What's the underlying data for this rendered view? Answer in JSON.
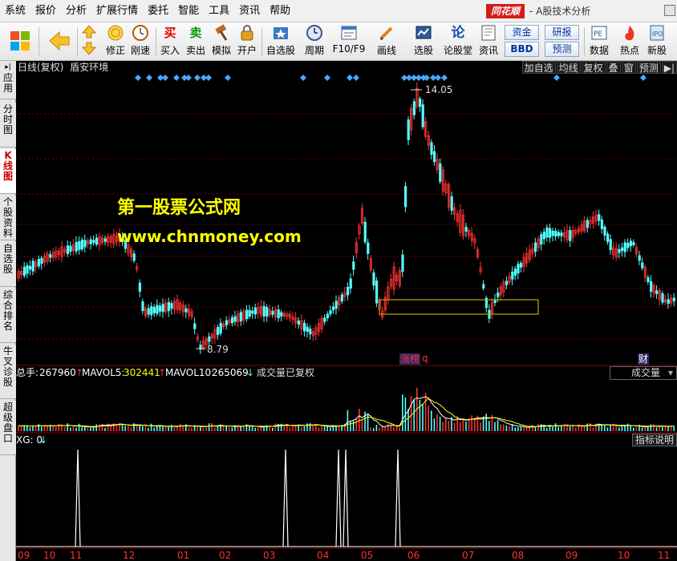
{
  "menu": [
    "系统",
    "报价",
    "分析",
    "扩展行情",
    "委托",
    "智能",
    "工具",
    "资讯",
    "帮助"
  ],
  "brand": "同花顺",
  "app_title": "- A股技术分析",
  "toolbar": {
    "buttons": [
      "修正",
      "刚速",
      "买入",
      "卖出",
      "模拟",
      "开户",
      "自选股",
      "周期",
      "F10/F9",
      "画线",
      "选股",
      "论股堂",
      "资讯",
      "数据",
      "热点",
      "新股"
    ],
    "icon_text": {
      "buy": "买",
      "sell": "卖",
      "lun": "论"
    },
    "mini": [
      "资金",
      "研报",
      "BBD",
      "预测"
    ]
  },
  "vtabs": [
    "应用",
    "分时图",
    "K线图",
    "个股资料",
    "自选股",
    "综合排名",
    "牛叉诊股",
    "超级盘口"
  ],
  "chart": {
    "title": "日线(复权)",
    "stock": "盾安环境",
    "buttons": [
      "加自选",
      "均线",
      "复权",
      "叠",
      "窗",
      "预测",
      "▶|"
    ],
    "high_label": "14.05",
    "low_label": "8.79",
    "events": {
      "zhangbang": "涨榜",
      "q": "q",
      "cai": "财"
    }
  },
  "watermark": {
    "line1": "第一股票公式网",
    "line2": "www.chnmoney.com"
  },
  "volume": {
    "total_label": "总手:",
    "total": "267960",
    "mavol5_label": "MAVOL5:",
    "mavol5": "302441",
    "mavol10_label": "MAVOL10:",
    "mavol10": "265069",
    "note": "成交量已复权",
    "dropdown": "成交量"
  },
  "indicator": {
    "label": "XG: 0",
    "arrow": "↓",
    "explain_button": "指标说明"
  },
  "x_axis": [
    "09",
    "10",
    "11",
    "12",
    "01",
    "02",
    "03",
    "04",
    "05",
    "06",
    "07",
    "08",
    "09",
    "10",
    "11"
  ],
  "colors": {
    "up": "#ff3232",
    "down": "#54ffff",
    "diamond": "#4aa8ff",
    "watermark": "#ffff00",
    "box": "#c8a000"
  }
}
